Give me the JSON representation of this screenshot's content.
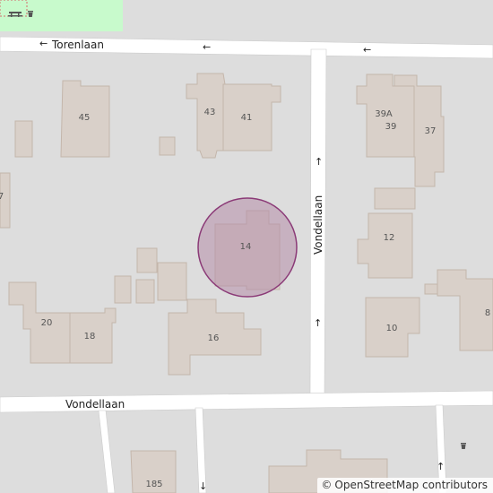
{
  "map": {
    "streets": {
      "top": "Torenlaan",
      "vertical": "Vondellaan",
      "bottom": "Vondellaan"
    },
    "arrows": {
      "left": "←",
      "up": "↑",
      "down": "↓"
    },
    "house_numbers": {
      "n45": "45",
      "n43": "43",
      "n41": "41",
      "n39a": "39A",
      "n39": "39",
      "n37": "37",
      "n14": "14",
      "n12": "12",
      "n20": "20",
      "n18": "18",
      "n16": "16",
      "n10": "10",
      "n8": "8",
      "n185": "185",
      "n7": "7"
    },
    "icons": {
      "trash": "waste-basket-icon",
      "picnic": "picnic-table-icon"
    },
    "colors": {
      "background": "#dddddd",
      "road": "#ffffff",
      "building": "#d9d0c9",
      "building_outline": "#c4b6ab",
      "park": "#c8facc",
      "marker_fill": "#b48ca8",
      "marker_stroke": "#8b3a77"
    }
  },
  "attribution": {
    "copyright_symbol": "©",
    "text": "OpenStreetMap contributors"
  }
}
